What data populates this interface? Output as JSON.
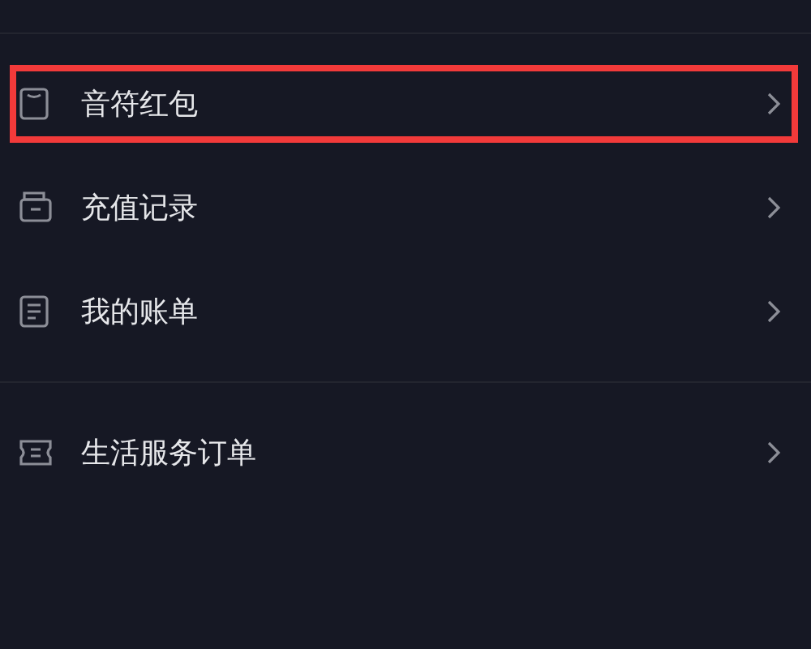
{
  "sections": [
    {
      "items": [
        {
          "label": "音符红包",
          "kind": "envelope",
          "highlighted": true
        },
        {
          "label": "充值记录",
          "kind": "wallet",
          "highlighted": false
        },
        {
          "label": "我的账单",
          "kind": "list",
          "highlighted": false
        }
      ]
    },
    {
      "items": [
        {
          "label": "生活服务订单",
          "kind": "ticket",
          "highlighted": false
        }
      ]
    }
  ]
}
